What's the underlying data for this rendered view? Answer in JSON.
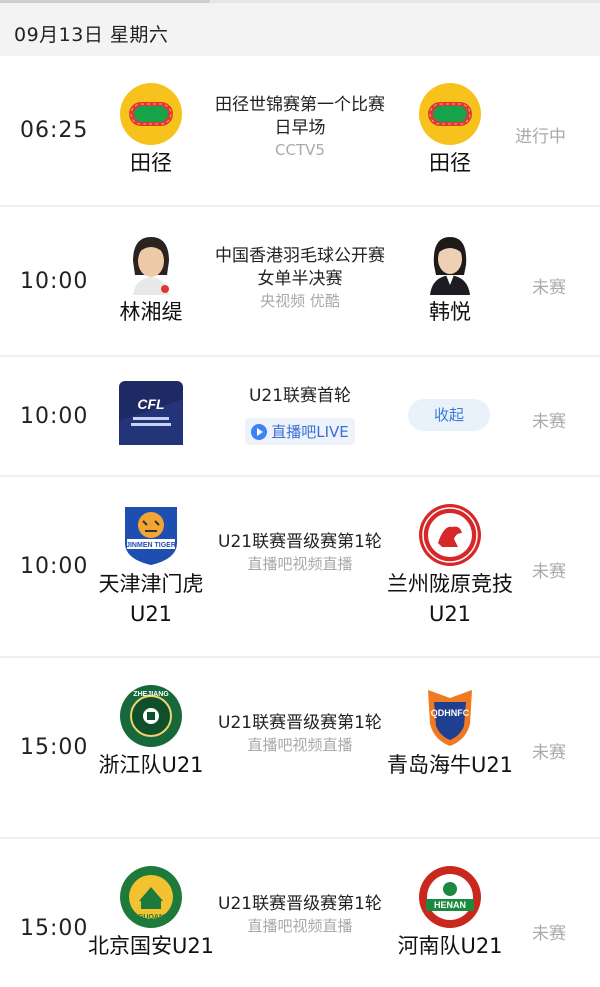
{
  "date_header": "09月13日 星期六",
  "matches": [
    {
      "time": "06:25",
      "home_name": "田径",
      "home_icon": "track-icon",
      "away_name": "田径",
      "away_icon": "track-icon",
      "title": "田径世锦赛第一个比赛日早场",
      "channel": "CCTV5",
      "status": "进行中"
    },
    {
      "time": "10:00",
      "home_name": "林湘缇",
      "home_icon": "player-avatar-icon",
      "away_name": "韩悦",
      "away_icon": "player-avatar-icon",
      "title": "中国香港羽毛球公开赛女单半决赛",
      "channel": "央视频 优酷",
      "status": "未赛"
    },
    {
      "time": "10:00",
      "home_icon": "cfl-league-logo-icon",
      "title": "U21联赛首轮",
      "live_label": "直播吧LIVE",
      "collapse_label": "收起",
      "status": "未赛"
    },
    {
      "time": "10:00",
      "home_name": "天津津门虎U21",
      "home_icon": "tianjin-tiger-logo-icon",
      "away_name": "兰州陇原竞技U21",
      "away_icon": "lanzhou-logo-icon",
      "title": "U21联赛晋级赛第1轮",
      "channel": "直播吧视频直播",
      "status": "未赛"
    },
    {
      "time": "15:00",
      "home_name": "浙江队U21",
      "home_icon": "zhejiang-logo-icon",
      "away_name": "青岛海牛U21",
      "away_icon": "qingdao-logo-icon",
      "title": "U21联赛晋级赛第1轮",
      "channel": "直播吧视频直播",
      "status": "未赛"
    },
    {
      "time": "15:00",
      "home_name": "北京国安U21",
      "home_icon": "beijing-guoan-logo-icon",
      "away_name": "河南队U21",
      "away_icon": "henan-logo-icon",
      "title": "U21联赛晋级赛第1轮",
      "channel": "直播吧视频直播",
      "status": "未赛"
    }
  ],
  "colors": {
    "track_yellow": "#f6c21b",
    "track_red": "#e0382c",
    "track_green": "#17a34a",
    "status_grey": "#aaaaaa",
    "accent_blue": "#3a7ad6"
  }
}
